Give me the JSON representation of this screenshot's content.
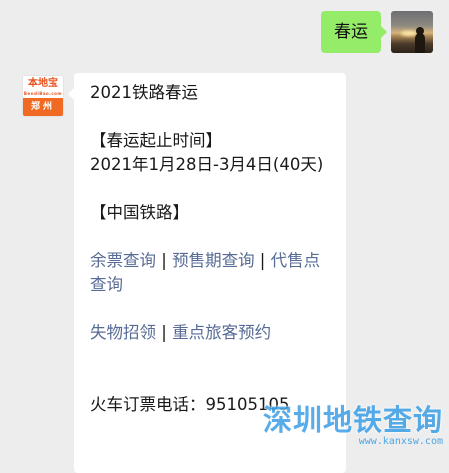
{
  "outgoing": {
    "text": "春运"
  },
  "incoming": {
    "avatar": {
      "brand": "本地宝",
      "brand_sub": "BendiBao.com",
      "city": "郑州"
    },
    "title": "2021铁路春运",
    "period_header": "【春运起止时间】",
    "period_value": "2021年1月28日-3月4日(40天)",
    "railway_header": "【中国铁路】",
    "links_row1": {
      "link1": "余票查询",
      "link2": "预售期查询",
      "link3": "代售点查询"
    },
    "links_row2": {
      "link1": "失物招领",
      "link2": "重点旅客预约"
    },
    "separator": " | ",
    "phone_label": "火车订票电话：",
    "phone_value": "95105105"
  },
  "watermark": {
    "title": "深圳地铁查询",
    "url": "www.kanxsw.com"
  }
}
